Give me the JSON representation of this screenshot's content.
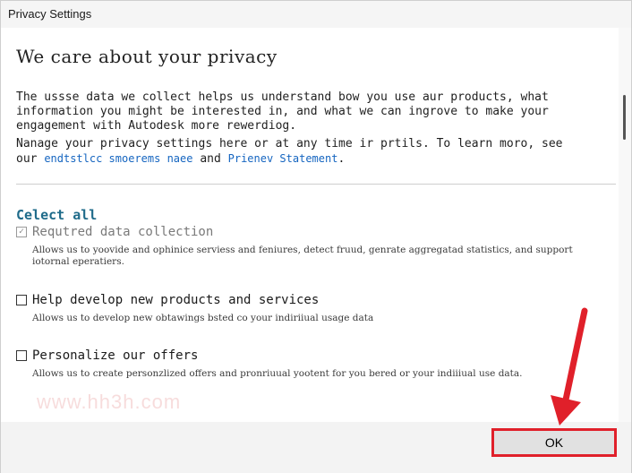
{
  "window": {
    "title": "Privacy Settings"
  },
  "main": {
    "heading": "We care about your privacy",
    "paragraph1": "The ussse data we collect helps us understand bow you use aur products, what information you might be interested in, and what we can ingrove to make your engagement with Autodesk more rewerdiog.",
    "paragraph2_text": "Nanage your privacy settings here or at any time ir prtils. To learn moro, see our",
    "paragraph2_link1": "endtstlcc smoerems naee",
    "paragraph2_and": "and",
    "paragraph2_link2": "Prienev Statement",
    "paragraph2_end": ".",
    "select_all": "Celect all"
  },
  "options": [
    {
      "label": "Requtred data collection",
      "checked": true,
      "disabled": true,
      "check_symbol": "✓",
      "description": "Allows us to yoovide and ophinice serviess and feniures, detect fruud, genrate aggregatad statistics, and support iotornal eperatiers."
    },
    {
      "label": "Help develop new products and services",
      "checked": false,
      "disabled": false,
      "check_symbol": "",
      "description": "Allows us to develop new obtawings bsted co your indiriiual usage data"
    },
    {
      "label": "Personalize our offers",
      "checked": false,
      "disabled": false,
      "check_symbol": "",
      "description": "Allows us to create personzlized offers and pronriuual yootent for you bered or your indiiiual use data."
    }
  ],
  "watermark": "www.hh3h.com",
  "footer": {
    "ok_label": "OK"
  },
  "colors": {
    "link": "#1565c0",
    "accent": "#1f6b8a",
    "highlight": "#e0202a"
  }
}
